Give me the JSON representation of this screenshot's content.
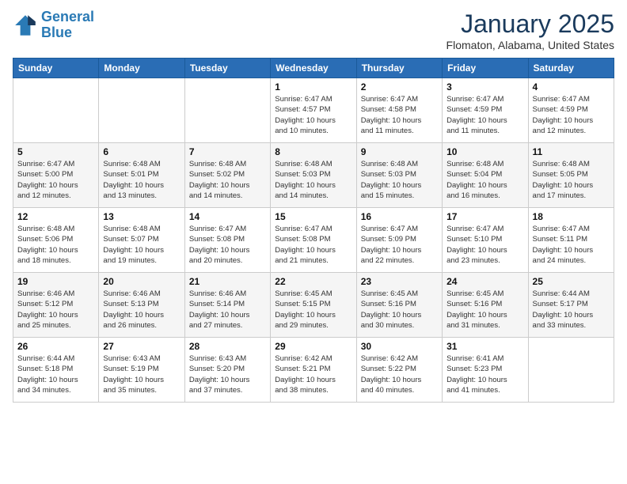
{
  "header": {
    "logo_line1": "General",
    "logo_line2": "Blue",
    "month": "January 2025",
    "location": "Flomaton, Alabama, United States"
  },
  "days_of_week": [
    "Sunday",
    "Monday",
    "Tuesday",
    "Wednesday",
    "Thursday",
    "Friday",
    "Saturday"
  ],
  "weeks": [
    [
      {
        "num": "",
        "info": ""
      },
      {
        "num": "",
        "info": ""
      },
      {
        "num": "",
        "info": ""
      },
      {
        "num": "1",
        "info": "Sunrise: 6:47 AM\nSunset: 4:57 PM\nDaylight: 10 hours\nand 10 minutes."
      },
      {
        "num": "2",
        "info": "Sunrise: 6:47 AM\nSunset: 4:58 PM\nDaylight: 10 hours\nand 11 minutes."
      },
      {
        "num": "3",
        "info": "Sunrise: 6:47 AM\nSunset: 4:59 PM\nDaylight: 10 hours\nand 11 minutes."
      },
      {
        "num": "4",
        "info": "Sunrise: 6:47 AM\nSunset: 4:59 PM\nDaylight: 10 hours\nand 12 minutes."
      }
    ],
    [
      {
        "num": "5",
        "info": "Sunrise: 6:47 AM\nSunset: 5:00 PM\nDaylight: 10 hours\nand 12 minutes."
      },
      {
        "num": "6",
        "info": "Sunrise: 6:48 AM\nSunset: 5:01 PM\nDaylight: 10 hours\nand 13 minutes."
      },
      {
        "num": "7",
        "info": "Sunrise: 6:48 AM\nSunset: 5:02 PM\nDaylight: 10 hours\nand 14 minutes."
      },
      {
        "num": "8",
        "info": "Sunrise: 6:48 AM\nSunset: 5:03 PM\nDaylight: 10 hours\nand 14 minutes."
      },
      {
        "num": "9",
        "info": "Sunrise: 6:48 AM\nSunset: 5:03 PM\nDaylight: 10 hours\nand 15 minutes."
      },
      {
        "num": "10",
        "info": "Sunrise: 6:48 AM\nSunset: 5:04 PM\nDaylight: 10 hours\nand 16 minutes."
      },
      {
        "num": "11",
        "info": "Sunrise: 6:48 AM\nSunset: 5:05 PM\nDaylight: 10 hours\nand 17 minutes."
      }
    ],
    [
      {
        "num": "12",
        "info": "Sunrise: 6:48 AM\nSunset: 5:06 PM\nDaylight: 10 hours\nand 18 minutes."
      },
      {
        "num": "13",
        "info": "Sunrise: 6:48 AM\nSunset: 5:07 PM\nDaylight: 10 hours\nand 19 minutes."
      },
      {
        "num": "14",
        "info": "Sunrise: 6:47 AM\nSunset: 5:08 PM\nDaylight: 10 hours\nand 20 minutes."
      },
      {
        "num": "15",
        "info": "Sunrise: 6:47 AM\nSunset: 5:08 PM\nDaylight: 10 hours\nand 21 minutes."
      },
      {
        "num": "16",
        "info": "Sunrise: 6:47 AM\nSunset: 5:09 PM\nDaylight: 10 hours\nand 22 minutes."
      },
      {
        "num": "17",
        "info": "Sunrise: 6:47 AM\nSunset: 5:10 PM\nDaylight: 10 hours\nand 23 minutes."
      },
      {
        "num": "18",
        "info": "Sunrise: 6:47 AM\nSunset: 5:11 PM\nDaylight: 10 hours\nand 24 minutes."
      }
    ],
    [
      {
        "num": "19",
        "info": "Sunrise: 6:46 AM\nSunset: 5:12 PM\nDaylight: 10 hours\nand 25 minutes."
      },
      {
        "num": "20",
        "info": "Sunrise: 6:46 AM\nSunset: 5:13 PM\nDaylight: 10 hours\nand 26 minutes."
      },
      {
        "num": "21",
        "info": "Sunrise: 6:46 AM\nSunset: 5:14 PM\nDaylight: 10 hours\nand 27 minutes."
      },
      {
        "num": "22",
        "info": "Sunrise: 6:45 AM\nSunset: 5:15 PM\nDaylight: 10 hours\nand 29 minutes."
      },
      {
        "num": "23",
        "info": "Sunrise: 6:45 AM\nSunset: 5:16 PM\nDaylight: 10 hours\nand 30 minutes."
      },
      {
        "num": "24",
        "info": "Sunrise: 6:45 AM\nSunset: 5:16 PM\nDaylight: 10 hours\nand 31 minutes."
      },
      {
        "num": "25",
        "info": "Sunrise: 6:44 AM\nSunset: 5:17 PM\nDaylight: 10 hours\nand 33 minutes."
      }
    ],
    [
      {
        "num": "26",
        "info": "Sunrise: 6:44 AM\nSunset: 5:18 PM\nDaylight: 10 hours\nand 34 minutes."
      },
      {
        "num": "27",
        "info": "Sunrise: 6:43 AM\nSunset: 5:19 PM\nDaylight: 10 hours\nand 35 minutes."
      },
      {
        "num": "28",
        "info": "Sunrise: 6:43 AM\nSunset: 5:20 PM\nDaylight: 10 hours\nand 37 minutes."
      },
      {
        "num": "29",
        "info": "Sunrise: 6:42 AM\nSunset: 5:21 PM\nDaylight: 10 hours\nand 38 minutes."
      },
      {
        "num": "30",
        "info": "Sunrise: 6:42 AM\nSunset: 5:22 PM\nDaylight: 10 hours\nand 40 minutes."
      },
      {
        "num": "31",
        "info": "Sunrise: 6:41 AM\nSunset: 5:23 PM\nDaylight: 10 hours\nand 41 minutes."
      },
      {
        "num": "",
        "info": ""
      }
    ]
  ]
}
